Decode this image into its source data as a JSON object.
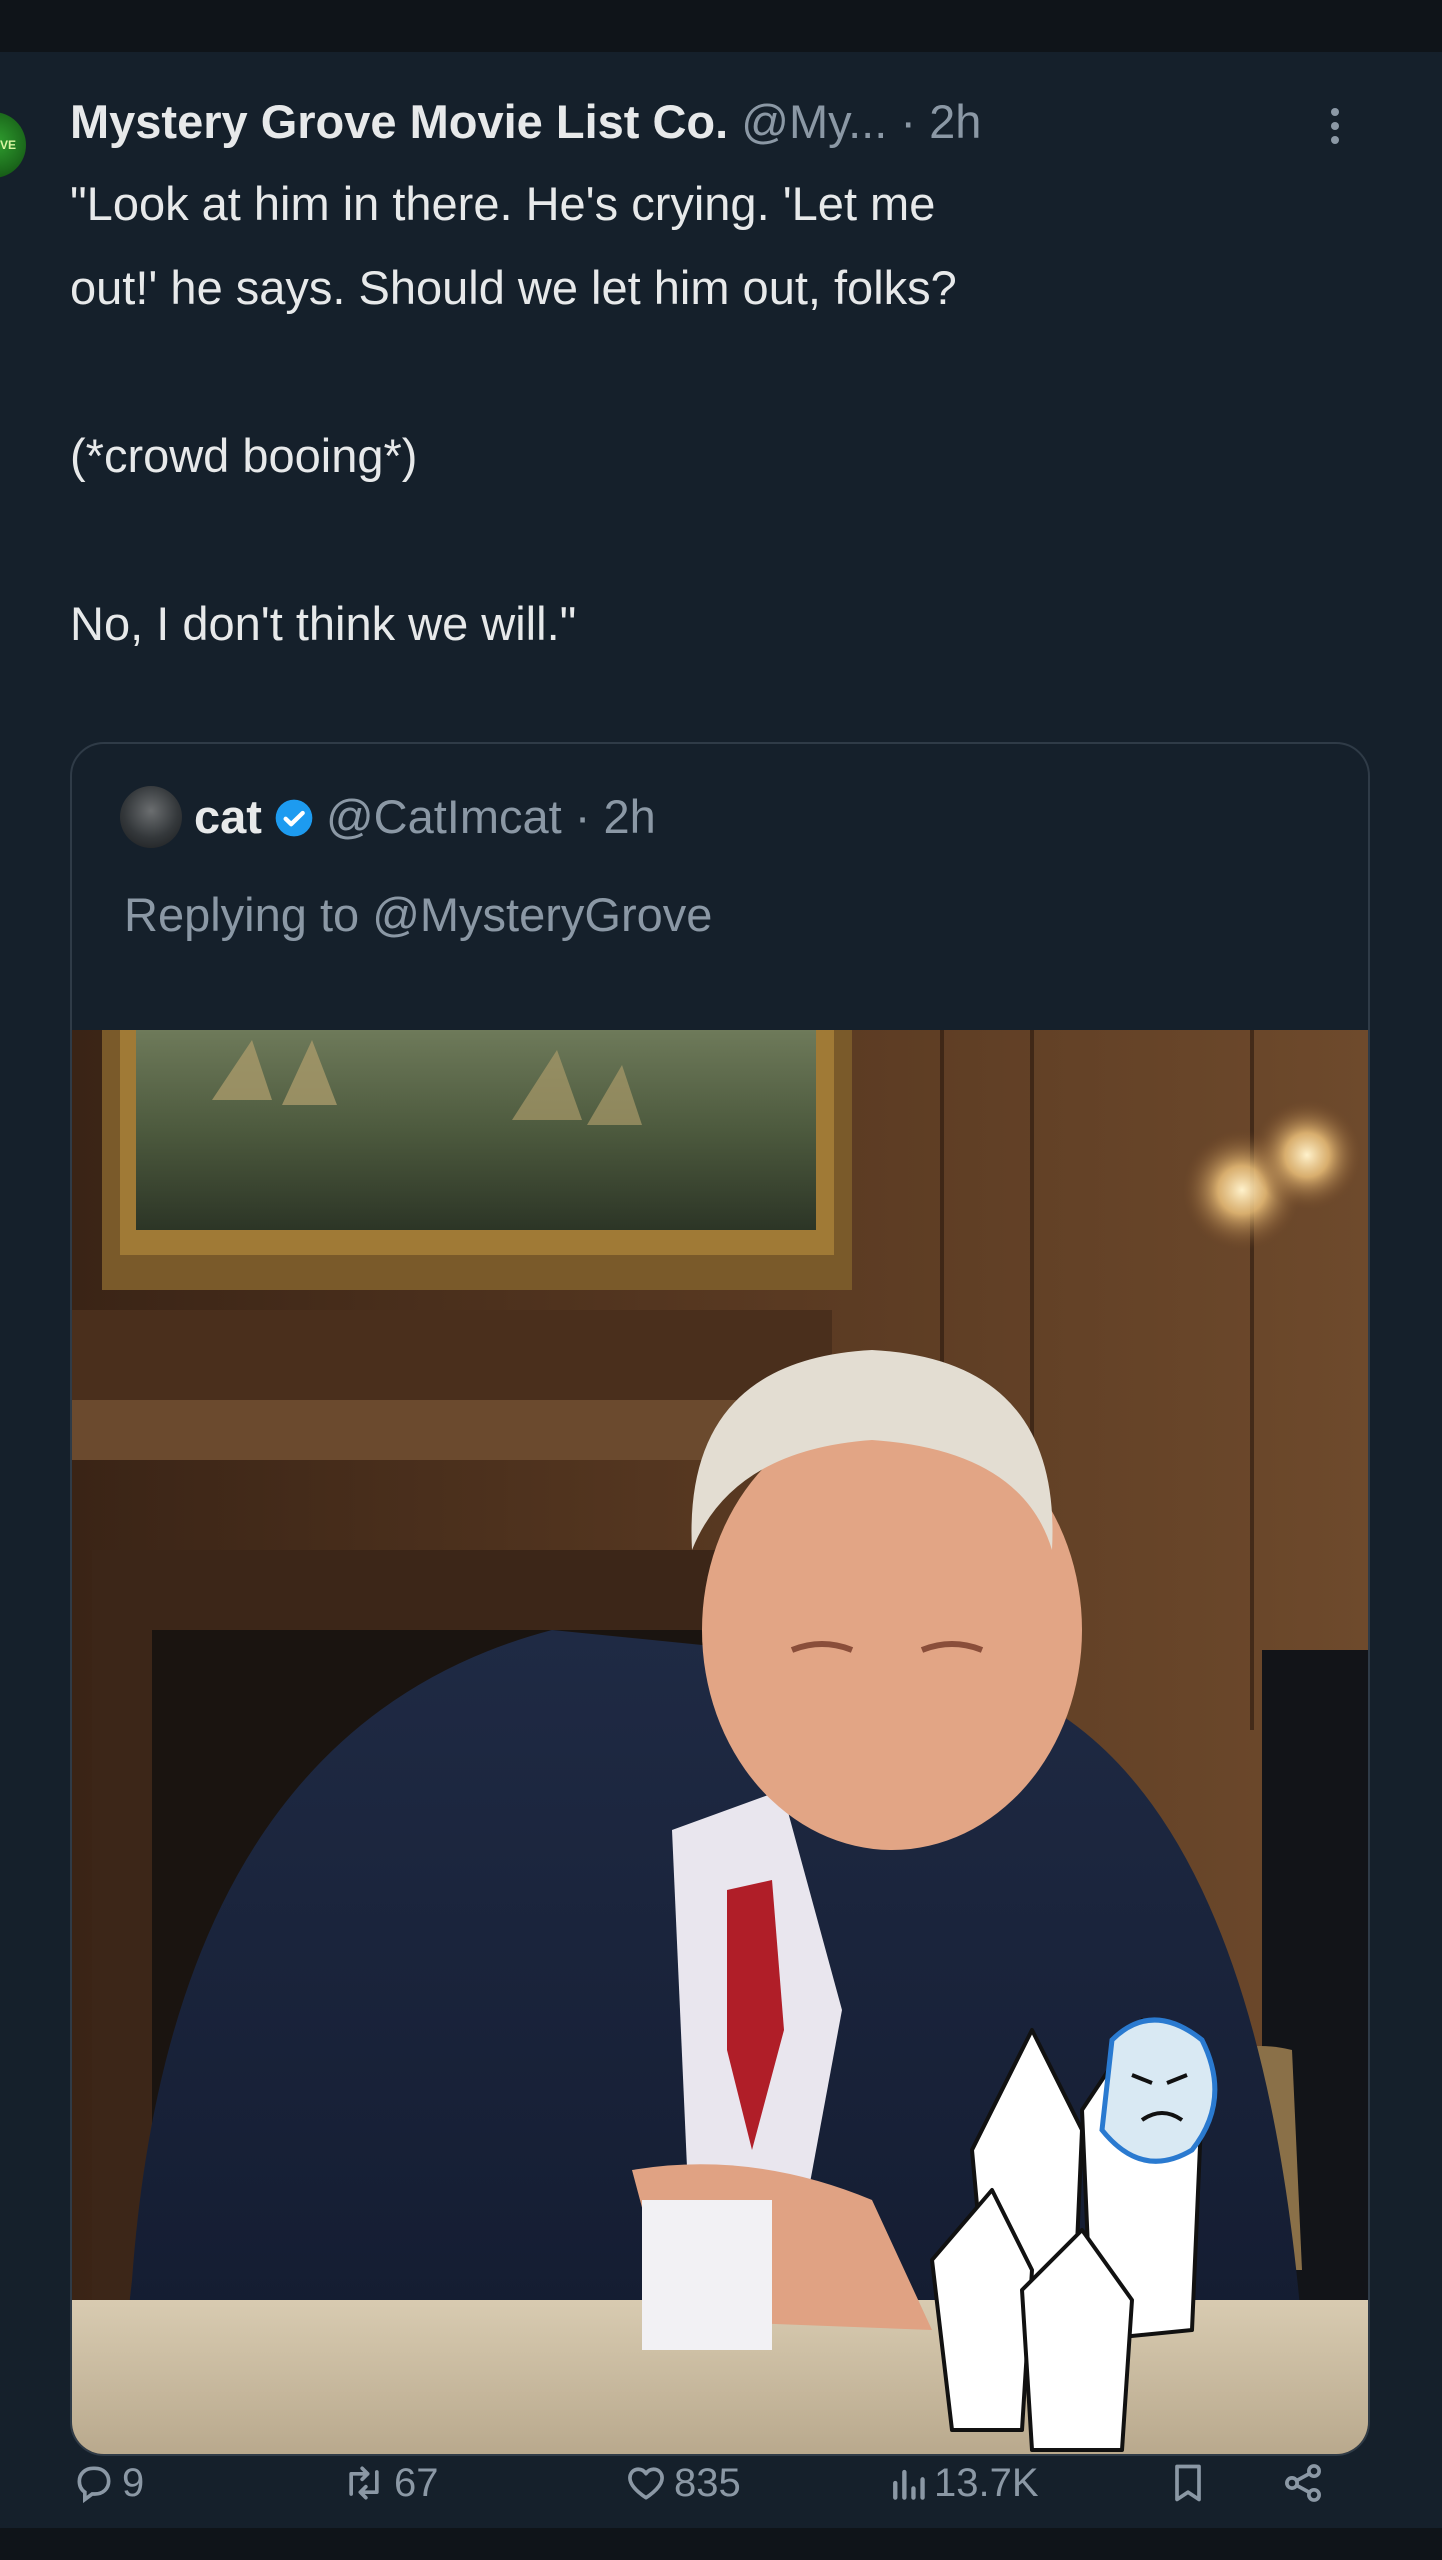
{
  "post": {
    "display_name": "Mystery Grove Movie List Co.",
    "handle": "@My...",
    "time": "· 2h",
    "avatar_text": "VE",
    "text_lines": [
      "\"Look at him in there. He's crying. 'Let me",
      "out!' he says. Should we let him out, folks?",
      "",
      "(*crowd booing*)",
      "",
      "No, I don't think we will.\""
    ]
  },
  "quote": {
    "display_name": "cat",
    "handle": "@CatImcat",
    "time": "· 2h",
    "replying_to": "Replying to @MysteryGrove",
    "image_alt": "photo of a seated man in a dark suit and red tie at a table with a drawn crying face inside a crystal"
  },
  "actions": {
    "replies": "9",
    "reposts": "67",
    "likes": "835",
    "views": "13.7K"
  },
  "colors": {
    "background": "#15202b",
    "text": "#e7e9ea",
    "muted": "#8b98a5",
    "verified": "#1d9bf0",
    "border": "#2f3b47"
  },
  "icons": [
    "more-icon",
    "verified-badge-icon",
    "reply-icon",
    "repost-icon",
    "like-icon",
    "views-icon",
    "bookmark-icon",
    "share-icon"
  ]
}
